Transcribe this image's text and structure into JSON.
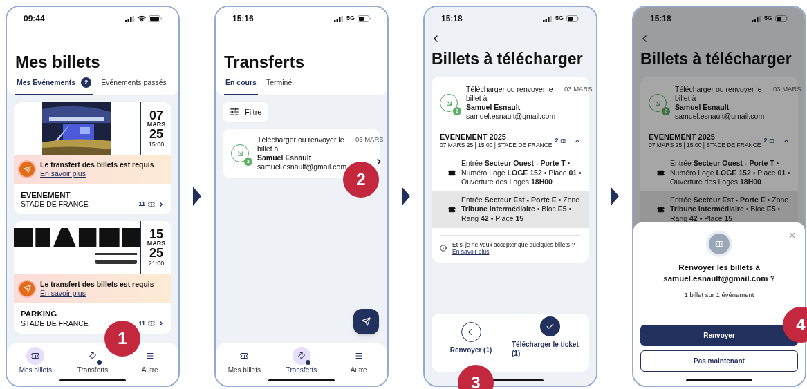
{
  "screens": [
    {
      "kind": "tickets",
      "status": {
        "time": "09:44"
      },
      "title": "Mes billets",
      "tabs": [
        {
          "label": "Mes Evénements",
          "count": "2",
          "selected": true
        },
        {
          "label": "Événements passés",
          "selected": false
        }
      ],
      "events": [
        {
          "kind": "picture",
          "day": "07",
          "month": "MARS",
          "year": "25",
          "time": "15:00",
          "alert": "Le transfert des billets est requis",
          "alert_link": "En savoir plus",
          "name": "EVENEMENT",
          "venue": "STADE DE FRANCE",
          "tickets": "11"
        },
        {
          "kind": "picture",
          "day": "15",
          "month": "MARS",
          "year": "25",
          "time": "21:00",
          "alert": "Le transfert des billets est requis",
          "alert_link": "En savoir plus",
          "name": "PARKING",
          "venue": "STADE DE FRANCE",
          "tickets": "11"
        }
      ],
      "nav": [
        {
          "label": "Mes billets",
          "selected": true,
          "dot": false
        },
        {
          "label": "Transferts",
          "selected": false,
          "dot": true
        },
        {
          "label": "Autre",
          "selected": false,
          "dot": false
        }
      ],
      "step": "1"
    },
    {
      "kind": "transfers",
      "status": {
        "time": "15:16",
        "network": "5G"
      },
      "title": "Transferts",
      "tabs": [
        {
          "label": "En cours",
          "selected": true
        },
        {
          "label": "Terminé",
          "selected": false
        }
      ],
      "filter": "Filtre",
      "transfers": [
        {
          "text": "Télécharger ou renvoyer le billet à",
          "name": "Samuel Esnault",
          "email": "samuel.esnault@gmail.com",
          "date": "03 MARS",
          "count": "2"
        }
      ],
      "nav": [
        {
          "label": "Mes billets",
          "selected": false,
          "dot": false
        },
        {
          "label": "Transferts",
          "selected": true,
          "dot": true
        },
        {
          "label": "Autre",
          "selected": false,
          "dot": false
        }
      ],
      "step": "2"
    },
    {
      "kind": "download",
      "dimmed": false,
      "status": {
        "time": "15:18",
        "network": "5G"
      },
      "title": "Billets à télécharger",
      "transfer": {
        "text": "Télécharger ou renvoyer le billet à",
        "name": "Samuel Esnault",
        "email": "samuel.esnault@gmail.com",
        "date": "03 MARS",
        "count": "2"
      },
      "event": {
        "name": "EVENEMENT 2025",
        "details": "07 MARS 25 | 15:00 | STADE DE FRANCE",
        "tickets": "2",
        "expanded": true,
        "rows": [
          {
            "text": "Entrée **Secteur Ouest - Porte T** • Numéro Loge **LOGE 152** • Place **01** • Ouverture des Loges **18H00**",
            "selected": false
          },
          {
            "text": "Entrée **Secteur Est - Porte E** • Zone **Tribune Intermédiaire** • Bloc **E5** • Rang **42** • Place **15**",
            "selected": true
          }
        ]
      },
      "note": {
        "text": "Et si je ne veux accepter que quelques billets ?",
        "link": "En savoir plus"
      },
      "actions": [
        {
          "label": "Renvoyer (1)",
          "kind": "outline"
        },
        {
          "label": "Télécharger le ticket (1)",
          "kind": "filled"
        }
      ],
      "step": "3"
    },
    {
      "kind": "download",
      "dimmed": true,
      "status": {
        "time": "15:18",
        "network": "5G"
      },
      "title": "Billets à télécharger",
      "transfer": {
        "text": "Télécharger ou renvoyer le billet à",
        "name": "Samuel Esnault",
        "email": "samuel.esnault@gmail.com",
        "date": "03 MARS",
        "count": "2"
      },
      "event": {
        "name": "EVENEMENT 2025",
        "details": "07 MARS 25 | 15:00 | STADE DE FRANCE",
        "tickets": "2",
        "expanded": true,
        "rows": [
          {
            "text": "Entrée **Secteur Ouest - Porte T** • Numéro Loge **LOGE 152** • Place **01** • Ouverture des Loges **18H00**",
            "selected": false
          },
          {
            "text": "Entrée **Secteur Est - Porte E** • Zone **Tribune Intermédiaire** • Bloc **E5** • Rang **42** • Place **15**",
            "selected": true
          }
        ]
      },
      "sheet": {
        "title": "Renvoyer les billets à samuel.esnault@gmail.com ?",
        "subtitle": "1 billet sur 1 événement",
        "buttons": [
          {
            "label": "Renvoyer",
            "kind": "primary"
          },
          {
            "label": "Pas maintenant",
            "kind": "secondary"
          }
        ]
      },
      "step": "4"
    }
  ]
}
